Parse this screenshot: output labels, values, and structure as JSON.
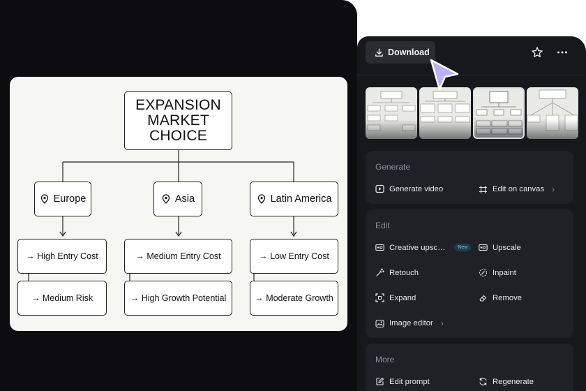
{
  "diagram": {
    "title": "EXPANSION MARKET CHOICE",
    "title_lines": [
      "EXPANSION",
      "MARKET",
      "CHOICE"
    ],
    "regions": [
      {
        "name": "Europe",
        "items": [
          "→ High Entry Cost",
          "→ Medium Risk"
        ]
      },
      {
        "name": "Asia",
        "items": [
          "→ Medium Entry Cost",
          "→ High Growth Potential"
        ]
      },
      {
        "name": "Latin America",
        "items": [
          "→ Low Entry Cost",
          "→ Moderate Growth"
        ]
      }
    ]
  },
  "toolbar": {
    "download_label": "Download",
    "favorite_icon": "star-icon",
    "more_icon": "more-horizontal-icon"
  },
  "thumbnails": {
    "count": 4,
    "selected_index": 2
  },
  "sections": {
    "generate": {
      "title": "Generate",
      "actions": [
        {
          "label": "Generate video",
          "icon": "play-square-icon"
        },
        {
          "label": "Edit on canvas",
          "icon": "crop-frame-icon"
        }
      ]
    },
    "edit": {
      "title": "Edit",
      "new_badge": "New",
      "actions": [
        {
          "label": "Creative upsc…",
          "icon": "hd-plus-icon"
        },
        {
          "label": "Upscale",
          "icon": "hd-icon"
        },
        {
          "label": "Retouch",
          "icon": "magic-wand-icon"
        },
        {
          "label": "Inpaint",
          "icon": "inpaint-icon"
        },
        {
          "label": "Expand",
          "icon": "expand-icon"
        },
        {
          "label": "Remove",
          "icon": "eraser-icon"
        },
        {
          "label": "Image editor",
          "icon": "image-editor-icon"
        }
      ]
    },
    "more": {
      "title": "More",
      "actions": [
        {
          "label": "Edit prompt",
          "icon": "edit-prompt-icon"
        },
        {
          "label": "Regenerate",
          "icon": "refresh-icon"
        }
      ]
    }
  },
  "colors": {
    "app_bg": "#17181c",
    "panel_bg": "#202126",
    "left_bg": "#0d0d0f",
    "cursor": "#b7b1ff"
  }
}
